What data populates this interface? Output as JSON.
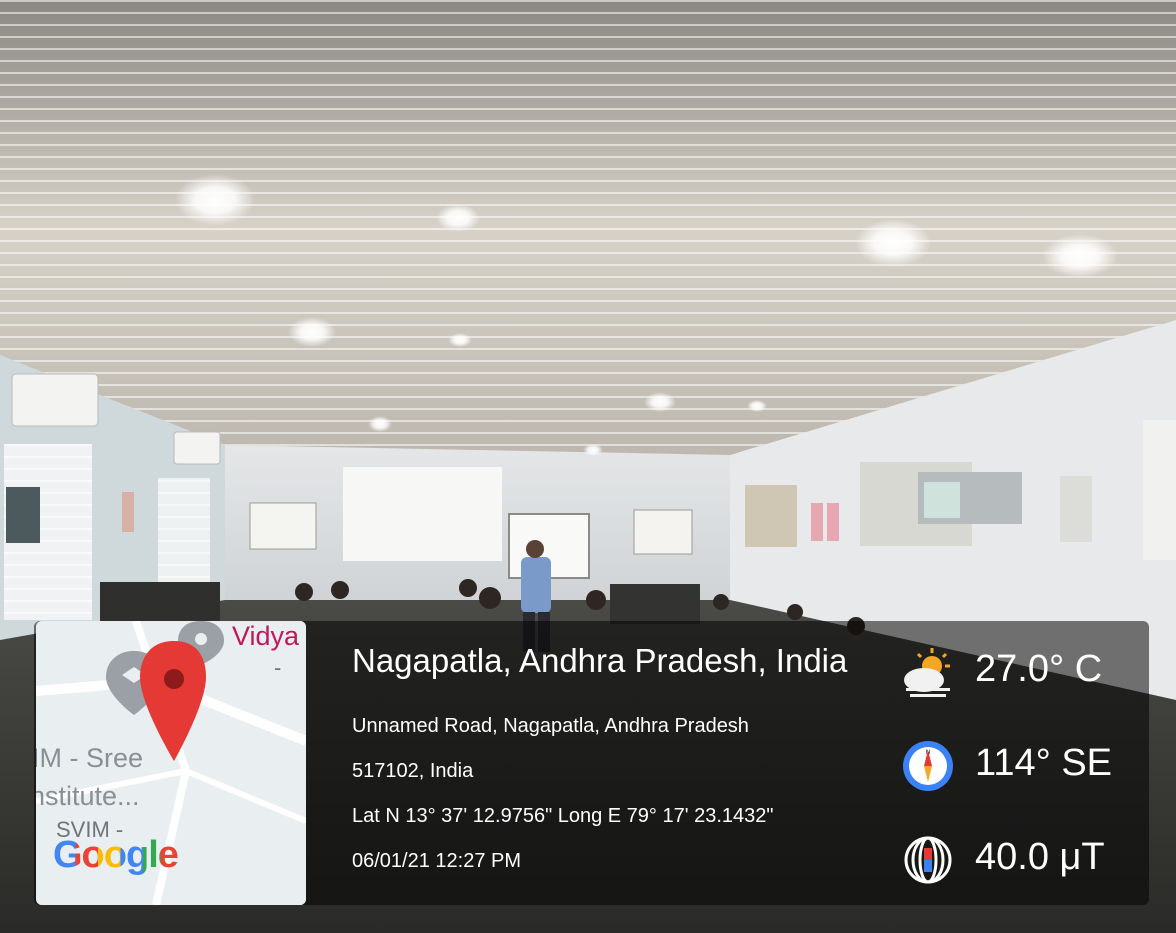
{
  "photo": {
    "subject": "classroom-computer-lab"
  },
  "map": {
    "labels": [
      "Vidya",
      "-",
      "IM - Sree",
      "nstitute...",
      "SVIM -"
    ],
    "google_logo": "Google",
    "pin_color": "#e53935"
  },
  "location": {
    "place": "Nagapatla, Andhra Pradesh, India",
    "address_line1": "Unnamed Road, Nagapatla, Andhra Pradesh",
    "address_line2": "517102, India",
    "coords": "Lat N 13° 37' 12.9756\" Long E 79° 17' 23.1432\"",
    "datetime": "06/01/21 12:27 PM"
  },
  "readings": {
    "temperature": "27.0° C",
    "bearing": "114° SE",
    "magnetic": "40.0 μT"
  }
}
